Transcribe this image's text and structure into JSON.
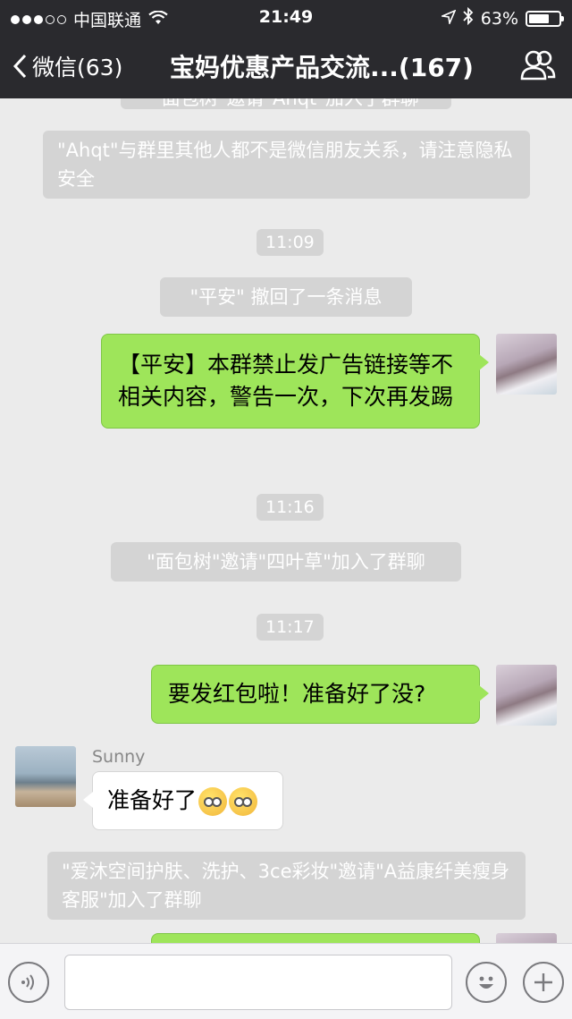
{
  "status_bar": {
    "carrier": "中国联通",
    "time": "21:49",
    "battery": "63%"
  },
  "nav": {
    "back_label": "微信(63)",
    "title": "宝妈优惠产品交流...(167)"
  },
  "chat": {
    "top_cut_notice": "\"面包树\"邀请\"Ahqt\"加入了群聊",
    "privacy_notice": "\"Ahqt\"与群里其他人都不是微信朋友关系，请注意隐私安全",
    "time_1": "11:09",
    "recall_notice": "\"平安\" 撤回了一条消息",
    "msg_warning": "【平安】本群禁止发广告链接等不相关内容，警告一次，下次再发踢",
    "time_2": "11:16",
    "join_notice_1": "\"面包树\"邀请\"四叶草\"加入了群聊",
    "time_3": "11:17",
    "msg_redpacket": "要发红包啦！准备好了没?",
    "sunny_name": "Sunny",
    "msg_sunny": "准备好了",
    "join_notice_2": "\"爱沐空间护肤、洗护、3ce彩妆\"邀请\"A益康纤美瘦身客服\"加入了群聊"
  },
  "input": {
    "placeholder": ""
  }
}
